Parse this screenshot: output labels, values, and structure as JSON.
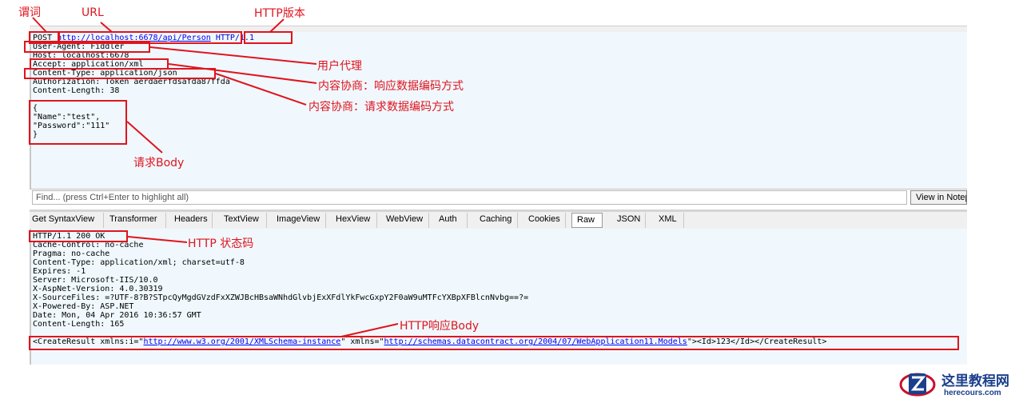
{
  "annotations": {
    "verb": "谓词",
    "url": "URL",
    "http_version": "HTTP版本",
    "user_agent": "用户代理",
    "accept": "内容协商：响应数据编码方式",
    "content_type": "内容协商：请求数据编码方式",
    "request_body": "请求Body",
    "status_code": "HTTP 状态码",
    "response_body": "HTTP响应Body"
  },
  "request": {
    "method": "POST",
    "url": "http://localhost:6678/api/Person",
    "version": "HTTP/1.1",
    "headers": [
      "User-Agent: Fiddler",
      "Host: localhost:6678",
      "Accept: application/xml",
      "Content-Type: application/json",
      "Authorization: Token aerdaerfdsafda87ffda",
      "Content-Length: 38"
    ],
    "body_lines": [
      "{",
      "\"Name\":\"test\",",
      "\"Password\":\"111\"",
      "}"
    ]
  },
  "find": {
    "placeholder": "Find... (press Ctrl+Enter to highlight all)",
    "view_in_notepad": "View in Notepad"
  },
  "tabs": [
    {
      "label": "Get SyntaxView"
    },
    {
      "label": "Transformer"
    },
    {
      "label": "Headers"
    },
    {
      "label": "TextView"
    },
    {
      "label": "ImageView"
    },
    {
      "label": "HexView"
    },
    {
      "label": "WebView"
    },
    {
      "label": "Auth"
    },
    {
      "label": "Caching"
    },
    {
      "label": "Cookies"
    },
    {
      "label": "Raw"
    },
    {
      "label": "JSON"
    },
    {
      "label": "XML"
    }
  ],
  "active_tab": "Raw",
  "response": {
    "status_line": "HTTP/1.1 200 OK",
    "headers": [
      "Cache-Control: no-cache",
      "Pragma: no-cache",
      "Content-Type: application/xml; charset=utf-8",
      "Expires: -1",
      "Server: Microsoft-IIS/10.0",
      "X-AspNet-Version: 4.0.30319",
      "X-SourceFiles: =?UTF-8?B?STpcQyMgdGVzdFxXZWJBcHBsaWNhdGlvbjExXFdlYkFwcGxpY2F0aW9uMTFcYXBpXFBlcnNvbg==?=",
      "X-Powered-By: ASP.NET",
      "Date: Mon, 04 Apr 2016 10:36:57 GMT",
      "Content-Length: 165"
    ],
    "body": {
      "p1": "<CreateResult xmlns:i=\"",
      "link1": "http://www.w3.org/2001/XMLSchema-instance",
      "p2": "\" xmlns=\"",
      "link2": "http://schemas.datacontract.org/2004/07/WebApplication11.Models",
      "p3": "\"><Id>123</Id></CreateResult>"
    }
  },
  "logo": {
    "title": "这里教程网",
    "domain": "herecours.com"
  },
  "colors": {
    "annotation": "#e0141e",
    "panel_bg": "#f0f8fd",
    "link": "#0000ee",
    "logo": "#1c3f8c"
  }
}
